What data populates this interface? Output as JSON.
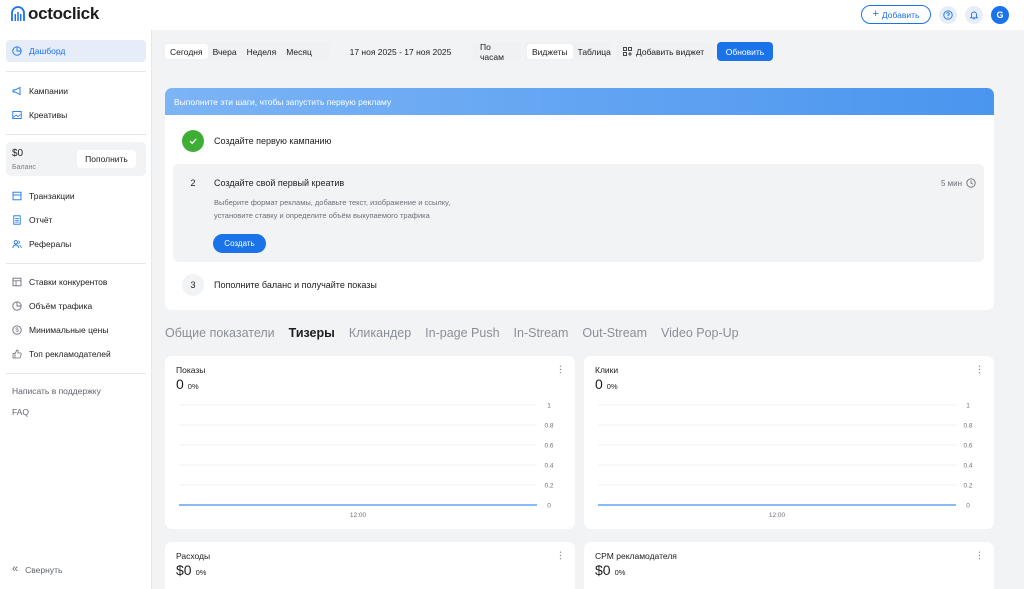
{
  "brand": {
    "name": "octoclick"
  },
  "header": {
    "add_label": "Добавить",
    "avatar_letter": "G"
  },
  "sidebar": {
    "dashboard": "Дашборд",
    "campaigns": "Кампании",
    "creatives": "Креативы",
    "balance_amount": "$0",
    "balance_label": "Баланс",
    "topup": "Пополнить",
    "transactions": "Транзакции",
    "report": "Отчёт",
    "referrals": "Рефералы",
    "competitor_bids": "Ставки конкурентов",
    "traffic_volume": "Объём трафика",
    "min_prices": "Минимальные цены",
    "top_advertisers": "Топ рекламодателей",
    "support": "Написать в поддержку",
    "faq": "FAQ",
    "collapse": "Свернуть"
  },
  "filters": {
    "periods": [
      "Сегодня",
      "Вчера",
      "Неделя",
      "Месяц"
    ],
    "date_range": "17 ноя 2025 - 17 ноя 2025",
    "granularity": "По часам",
    "view_widgets": "Виджеты",
    "view_table": "Таблица",
    "add_widget": "Добавить виджет",
    "refresh": "Обновить"
  },
  "onboarding": {
    "header": "Выполните эти шаги, чтобы запустить первую рекламу",
    "step1_title": "Создайте первую кампанию",
    "step2_num": "2",
    "step2_title": "Создайте свой первый креатив",
    "step2_desc1": "Выберите формат рекламы, добавьте текст, изображение и ссылку,",
    "step2_desc2": "установите ставку и определите объём выкупаемого трафика",
    "step2_button": "Создать",
    "step2_time": "5 мин",
    "step3_num": "3",
    "step3_title": "Пополните баланс и получайте показы"
  },
  "tabs": [
    "Общие показатели",
    "Тизеры",
    "Кликандер",
    "In-page Push",
    "In-Stream",
    "Out-Stream",
    "Video Pop-Up"
  ],
  "active_tab": "Тизеры",
  "stats": {
    "impressions": {
      "title": "Показы",
      "value": "0",
      "pct": "0%"
    },
    "clicks": {
      "title": "Клики",
      "value": "0",
      "pct": "0%"
    },
    "spend": {
      "title": "Расходы",
      "value": "$0",
      "pct": "0%"
    },
    "cpm": {
      "title": "CPM рекламодателя",
      "value": "$0",
      "pct": "0%"
    }
  },
  "chart_data": [
    {
      "type": "line",
      "title": "Показы",
      "x": [
        "12:00"
      ],
      "series": [
        {
          "values": [
            0
          ]
        }
      ],
      "ylim": [
        0,
        1
      ],
      "yticks": [
        "1",
        "0.8",
        "0.6",
        "0.4",
        "0.2",
        "0"
      ],
      "xticks": [
        "12:00"
      ]
    },
    {
      "type": "line",
      "title": "Клики",
      "x": [
        "12:00"
      ],
      "series": [
        {
          "values": [
            0
          ]
        }
      ],
      "ylim": [
        0,
        1
      ],
      "yticks": [
        "1",
        "0.8",
        "0.6",
        "0.4",
        "0.2",
        "0"
      ],
      "xticks": [
        "12:00"
      ]
    }
  ],
  "colors": {
    "accent": "#1a73e8",
    "success": "#3fae35",
    "gradient_start": "#7cb4f5",
    "gradient_end": "#4a95ef"
  }
}
